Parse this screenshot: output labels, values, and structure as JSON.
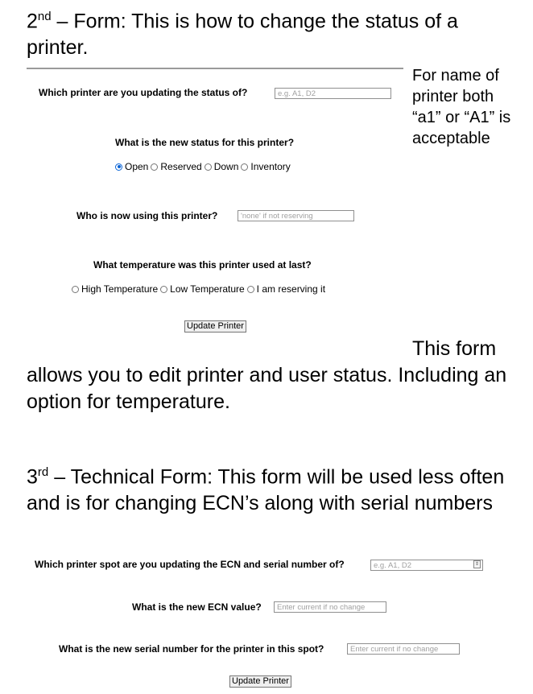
{
  "section2": {
    "heading_num": "2",
    "heading_sup": "nd",
    "heading_rest": " – Form: This is how to change the status of a printer.",
    "side_note": "For name of printer both “a1” or “A1” is acceptable",
    "q_printer": "Which printer are you updating the status of?",
    "printer_placeholder": "e.g. A1, D2",
    "q_status": "What is the new status for this printer?",
    "status_options": [
      "Open",
      "Reserved",
      "Down",
      "Inventory"
    ],
    "status_selected": "Open",
    "q_user": "Who is now using this printer?",
    "user_placeholder": "'none' if not reserving",
    "q_temp": "What temperature was this printer used at last?",
    "temp_options": [
      "High Temperature",
      "Low Temperature",
      "I am reserving it"
    ],
    "button_label": "Update Printer",
    "description": "This form allows you to edit printer and user status. Including an option for temperature."
  },
  "section3": {
    "heading_num": "3",
    "heading_sup": "rd",
    "heading_rest": " – Technical Form: This form will be used less often and is for changing ECN’s along with serial numbers",
    "q_spot": "Which printer spot are you updating the ECN and serial number of?",
    "spot_placeholder": "e.g. A1, D2",
    "q_ecn": "What is the new ECN value?",
    "ecn_placeholder": "Enter current if no change",
    "q_serial": "What is the new serial number for the printer in this spot?",
    "serial_placeholder": "Enter current if no change",
    "button_label": "Update Printer"
  },
  "colors": {
    "radio_checked": "#0a64d6",
    "divider": "#9a9a9a",
    "placeholder": "#a0a0a0"
  }
}
